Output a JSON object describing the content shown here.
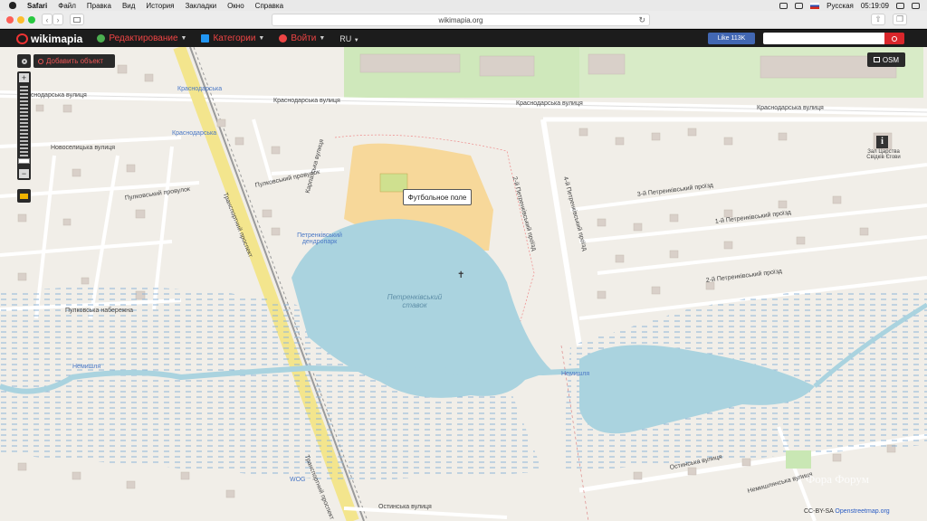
{
  "menubar": {
    "items": [
      {
        "label": "Safari",
        "bold": true
      },
      {
        "label": "Файл"
      },
      {
        "label": "Правка"
      },
      {
        "label": "Вид"
      },
      {
        "label": "История"
      },
      {
        "label": "Закладки"
      },
      {
        "label": "Окно"
      },
      {
        "label": "Справка"
      }
    ],
    "lang": "Русская",
    "clock": "05:19:09"
  },
  "browser": {
    "url": "wikimapia.org"
  },
  "header": {
    "logo": "wikimapia",
    "menu": [
      {
        "label": "Редактирование",
        "icon": "globe-icon",
        "color": "#4caf50"
      },
      {
        "label": "Категории",
        "icon": "categories-icon",
        "color": "#2196f3"
      },
      {
        "label": "Войти",
        "icon": "login-icon",
        "color": "#e44"
      }
    ],
    "lang": "RU",
    "like": "Like 113K",
    "search_placeholder": ""
  },
  "map": {
    "add_object": "Добавить объект",
    "osm": "OSM",
    "tooltip": "Футбольное поле",
    "watermark": "Фора Форум",
    "attribution_prefix": "CC-BY-SA",
    "attribution_link": "Openstreetmap.org",
    "labels": {
      "krasnodarskaya1": "Краснодарська вулиця",
      "krasnodarskaya2": "Краснодарська вулиця",
      "krasnodarskaya3": "Краснодарська вулиця",
      "krasnodarskaya_stop": "Краснодарська",
      "krasnodarskaya_stop2": "Краснодарська",
      "novoelitskaya": "Новоселицька вулиця",
      "pulkovskiy1": "Пулковський провулок",
      "pulkovskiy2": "Пулковський провулок",
      "pulkovska_nab": "Пулковська набережна",
      "transport_prospect": "Транспортний проспект",
      "petrenkivskiy_stavok": "Петренківський ставок",
      "petrenkivskiy_park": "Петренківський дендропарк",
      "petrenkivskiy_1": "1-й Петренківський проїзд",
      "petrenkivskiy_2": "2-й Петренківський проїзд",
      "petrenkivskiy_3": "3-й Петренківський проїзд",
      "petrenkivskiy_4": "4-й Петренківський проїзд",
      "petrenkivskiy_5": "2-й Петренківський проїзд",
      "nemyshlianska": "Немишлянська вулиця",
      "ostrinska": "Остинська вулиця",
      "ostrinska2": "Остинська вулиця",
      "church": "Зал Царства Свідків Єгови",
      "kartsev": "Карпатська вулиця",
      "nemyshlia": "Немишля",
      "nemyshlia2": "Немишля",
      "wog": "WOG"
    }
  }
}
